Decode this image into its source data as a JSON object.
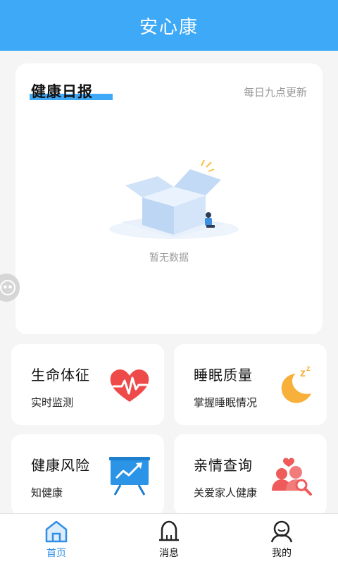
{
  "header": {
    "title": "安心康"
  },
  "report": {
    "title": "健康日报",
    "update_note": "每日九点更新",
    "empty_text": "暂无数据"
  },
  "tiles": [
    {
      "title": "生命体征",
      "subtitle": "实时监测",
      "icon": "heart-pulse-icon"
    },
    {
      "title": "睡眠质量",
      "subtitle": "掌握睡眠情况",
      "icon": "moon-sleep-icon"
    },
    {
      "title": "健康风险",
      "subtitle": "知健康",
      "icon": "trend-board-icon"
    },
    {
      "title": "亲情查询",
      "subtitle": "关爱家人健康",
      "icon": "family-search-icon"
    }
  ],
  "tabbar": {
    "items": [
      {
        "label": "首页",
        "icon": "home-icon",
        "active": true
      },
      {
        "label": "消息",
        "icon": "bell-icon",
        "active": false
      },
      {
        "label": "我的",
        "icon": "profile-icon",
        "active": false
      }
    ]
  },
  "colors": {
    "primary": "#3ea9f7",
    "active_tab": "#2f8ee6",
    "heart": "#ee4a4a",
    "moon": "#f7b03a",
    "board": "#2b94e6",
    "family": "#ef5a5a"
  }
}
